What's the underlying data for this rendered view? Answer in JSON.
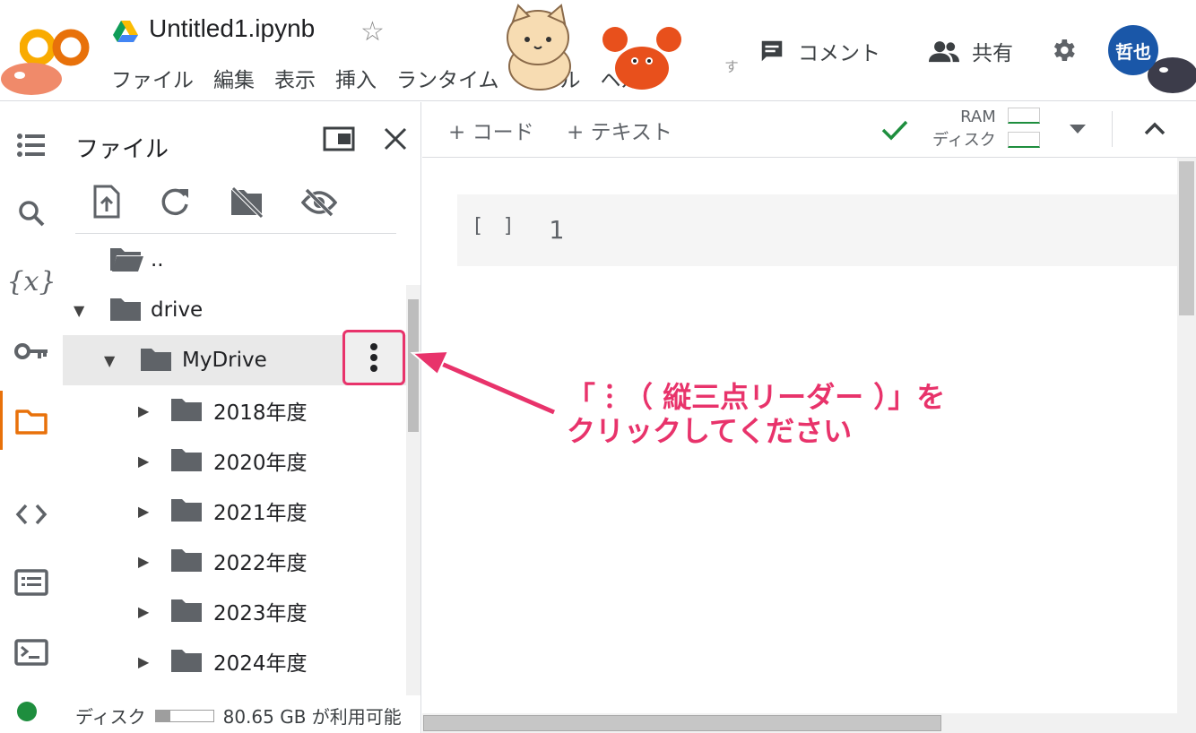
{
  "header": {
    "logo_text": "CO",
    "notebook_title": "Untitled1.ipynb",
    "menu": [
      "ファイル",
      "編集",
      "表示",
      "挿入",
      "ランタイム",
      "ツール",
      "ヘルプ"
    ],
    "menu_more": "す",
    "comment_label": "コメント",
    "share_label": "共有",
    "avatar_text": "哲也"
  },
  "rail": {
    "icons": [
      "table-of-contents-icon",
      "search-icon",
      "variables-icon",
      "key-icon",
      "folder-icon",
      "code-snippets-icon",
      "command-palette-icon",
      "terminal-icon"
    ],
    "active": "folder-icon",
    "status_color": "#1e8e3e"
  },
  "file_panel": {
    "title": "ファイル",
    "toolbar": [
      "upload-file-icon",
      "refresh-icon",
      "unmount-drive-icon",
      "hide-files-icon"
    ],
    "tree": [
      {
        "label": "..",
        "type": "folder-open",
        "expanded": null
      },
      {
        "label": "drive",
        "type": "folder",
        "expanded": true
      },
      {
        "label": "MyDrive",
        "type": "folder",
        "expanded": true,
        "selected": true
      },
      {
        "label": "2018年度",
        "type": "folder",
        "expanded": false
      },
      {
        "label": "2020年度",
        "type": "folder",
        "expanded": false
      },
      {
        "label": "2021年度",
        "type": "folder",
        "expanded": false
      },
      {
        "label": "2022年度",
        "type": "folder",
        "expanded": false
      },
      {
        "label": "2023年度",
        "type": "folder",
        "expanded": false
      },
      {
        "label": "2024年度",
        "type": "folder",
        "expanded": false
      }
    ],
    "disk_label": "ディスク",
    "disk_available": "80.65 GB が利用可能",
    "disk_used_fraction": 0.25
  },
  "main": {
    "add_code_label": "+ コード",
    "add_text_label": "+ テキスト",
    "ram_label": "RAM",
    "disk_label": "ディスク",
    "cell_run_marker": "[ ]",
    "cell_line_number": "1"
  },
  "annotation": {
    "line1": "「︙（ 縦三点リーダー ）」を",
    "line2": "クリックしてください",
    "color": "#e8336b"
  }
}
